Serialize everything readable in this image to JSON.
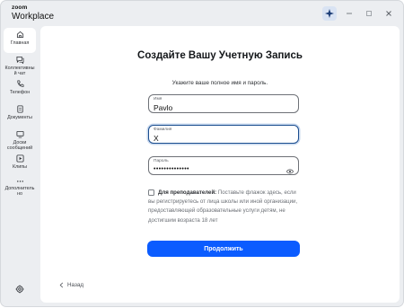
{
  "app": {
    "brand_top": "zoom",
    "brand_bottom": "Workplace"
  },
  "sidebar": {
    "items": [
      {
        "label": "Главная",
        "icon": "home-icon"
      },
      {
        "label": "Коллективны й чат",
        "icon": "chat-icon"
      },
      {
        "label": "Телефон",
        "icon": "phone-icon"
      },
      {
        "label": "Документы",
        "icon": "docs-icon"
      },
      {
        "label": "Доски сообщений",
        "icon": "whiteboard-icon"
      },
      {
        "label": "Клипы",
        "icon": "clips-icon"
      },
      {
        "label": "Дополнитель но",
        "icon": "more-icon"
      }
    ]
  },
  "form": {
    "title": "Создайте Вашу Учетную Запись",
    "subtitle": "Укажите ваше полное имя и пароль.",
    "first_name": {
      "label": "Имя",
      "value": "Pavlo"
    },
    "last_name": {
      "label": "Фамилия",
      "value": "X"
    },
    "password": {
      "label": "Пароль",
      "value": "••••••••••••••"
    },
    "teacher_bold": "Для преподавателей:",
    "teacher_text": " Поставьте флажок здесь, если вы регистрируетесь от лица школы или иной организации, предоставляющей образовательные услуги детям, не достигшим возраста 18 лет",
    "submit_label": "Продолжить",
    "back_label": "Назад"
  },
  "colors": {
    "accent": "#0b5cff",
    "focus_border": "#1b4e8f"
  }
}
